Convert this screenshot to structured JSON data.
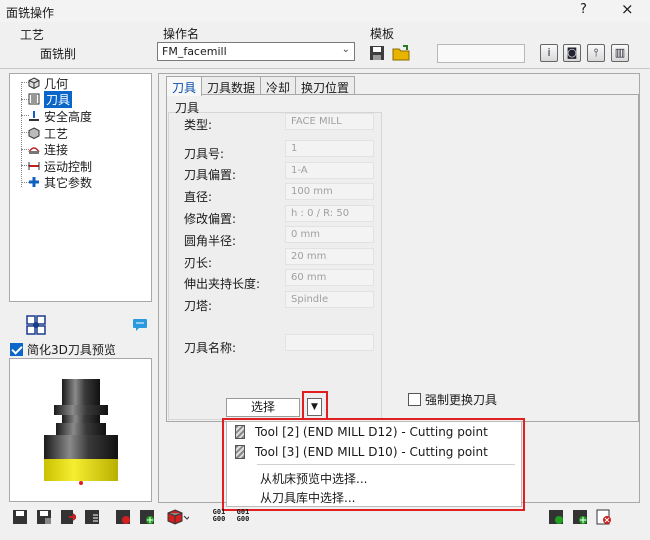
{
  "window": {
    "title": "面铣操作",
    "help_label": "?",
    "close_label": "×"
  },
  "header": {
    "process_label": "工艺",
    "process_value": "面铣削",
    "opname_label": "操作名",
    "opname_value": "FM_facemill",
    "template_label": "模板",
    "template_value": ""
  },
  "tree": {
    "items": [
      {
        "label": "几何",
        "icon": "cube-icon"
      },
      {
        "label": "刀具",
        "icon": "tool-list-icon",
        "selected": true
      },
      {
        "label": "安全高度",
        "icon": "safe-height-icon"
      },
      {
        "label": "工艺",
        "icon": "process-icon"
      },
      {
        "label": "连接",
        "icon": "link-icon"
      },
      {
        "label": "运动控制",
        "icon": "motion-icon"
      },
      {
        "label": "其它参数",
        "icon": "plus-params-icon"
      }
    ]
  },
  "preview": {
    "checkbox_label": "简化3D刀具预览",
    "checked": true
  },
  "tabs": [
    {
      "label": "刀具",
      "active": true
    },
    {
      "label": "刀具数据",
      "active": false
    },
    {
      "label": "冷却",
      "active": false
    },
    {
      "label": "换刀位置",
      "active": false
    }
  ],
  "tool_group": {
    "title": "刀具",
    "fields": [
      {
        "label": "类型:",
        "value": "FACE MILL"
      },
      {
        "label": "刀具号:",
        "value": "1"
      },
      {
        "label": "刀具偏置:",
        "value": "1-A"
      },
      {
        "label": "直径:",
        "value": "100 mm"
      },
      {
        "label": "修改偏置:",
        "value": "h : 0 / R: 50"
      },
      {
        "label": "圆角半径:",
        "value": "0 mm"
      },
      {
        "label": "刃长:",
        "value": "20 mm"
      },
      {
        "label": "伸出夹持长度:",
        "value": "60 mm"
      },
      {
        "label": "刀塔:",
        "value": "Spindle"
      },
      {
        "label": "刀具名称:",
        "value": ""
      }
    ]
  },
  "select_button_label": "选择",
  "force_change_label": "强制更换刀具",
  "force_change_checked": false,
  "dropdown_menu": {
    "tool_items": [
      "Tool [2] (END MILL D12) - Cutting point",
      "Tool [3] (END MILL D10) - Cutting point"
    ],
    "other_items": [
      "从机床预览中选择...",
      "从刀具库中选择..."
    ]
  },
  "bottom_bar": {
    "gcode_labels": [
      "G01\nG00",
      "G01\nG00"
    ]
  },
  "colors": {
    "selection_blue": "#0a66c8",
    "highlight_red": "#e02020",
    "tool_yellow": "#f2e600"
  }
}
